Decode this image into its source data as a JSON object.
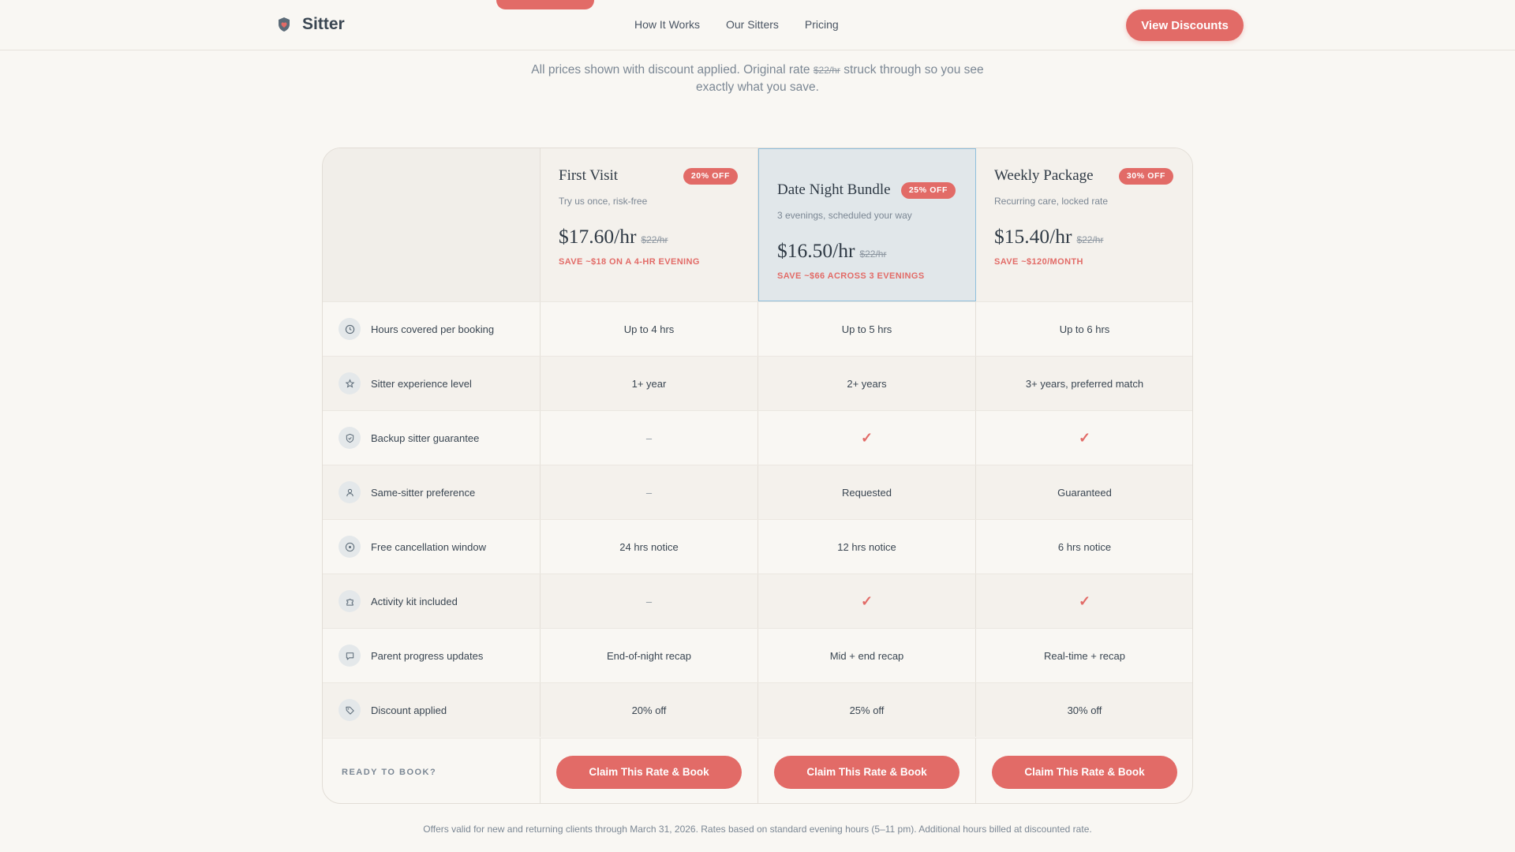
{
  "header": {
    "brand": "Sitter",
    "nav": [
      "How It Works",
      "Our Sitters",
      "Pricing"
    ],
    "cta": "View Discounts"
  },
  "intro": {
    "before": "All prices shown with discount applied. Original rate",
    "strike": "$22/hr",
    "after": "struck through so you see exactly what you save."
  },
  "plans": [
    {
      "name": "First Visit",
      "badge": "20% OFF",
      "desc": "Try us once, risk-free",
      "price": "$17.60/hr",
      "orig": "$22/hr",
      "save": "SAVE ~$18 ON A 4-HR EVENING",
      "cta": "Claim This Rate & Book"
    },
    {
      "name": "Date Night Bundle",
      "badge": "25% OFF",
      "desc": "3 evenings, scheduled your way",
      "price": "$16.50/hr",
      "orig": "$22/hr",
      "save": "SAVE ~$66 ACROSS 3 EVENINGS",
      "cta": "Claim This Rate & Book",
      "featured": true
    },
    {
      "name": "Weekly Package",
      "badge": "30% OFF",
      "desc": "Recurring care, locked rate",
      "price": "$15.40/hr",
      "orig": "$22/hr",
      "save": "SAVE ~$120/MONTH",
      "cta": "Claim This Rate & Book"
    }
  ],
  "features": [
    {
      "label": "Hours covered per booking",
      "icon": "clock-icon",
      "values": [
        "Up to 4 hrs",
        "Up to 5 hrs",
        "Up to 6 hrs"
      ]
    },
    {
      "label": "Sitter experience level",
      "icon": "star-icon",
      "values": [
        "1+ year",
        "2+ years",
        "3+ years, preferred match"
      ]
    },
    {
      "label": "Backup sitter guarantee",
      "icon": "shield-icon",
      "values": [
        "–",
        "✓",
        "✓"
      ]
    },
    {
      "label": "Same-sitter preference",
      "icon": "person-icon",
      "values": [
        "–",
        "Requested",
        "Guaranteed"
      ]
    },
    {
      "label": "Free cancellation window",
      "icon": "cancel-circle-icon",
      "values": [
        "24 hrs notice",
        "12 hrs notice",
        "6 hrs notice"
      ]
    },
    {
      "label": "Activity kit included",
      "icon": "puzzle-icon",
      "values": [
        "–",
        "✓",
        "✓"
      ]
    },
    {
      "label": "Parent progress updates",
      "icon": "chat-bubble-icon",
      "values": [
        "End-of-night recap",
        "Mid + end recap",
        "Real-time + recap"
      ]
    },
    {
      "label": "Discount applied",
      "icon": "tag-icon",
      "values": [
        "20% off",
        "25% off",
        "30% off"
      ]
    }
  ],
  "ready_label": "READY TO BOOK?",
  "disclaimer": "Offers valid for new and returning clients through March 31, 2026. Rates based on standard evening hours (5–11 pm). Additional hours billed at discounted rate.",
  "colors": {
    "accent": "#e26b67",
    "featured_bg": "#e1e7ea",
    "featured_border": "#8fbfdc",
    "page_bg": "#f9f7f3"
  }
}
